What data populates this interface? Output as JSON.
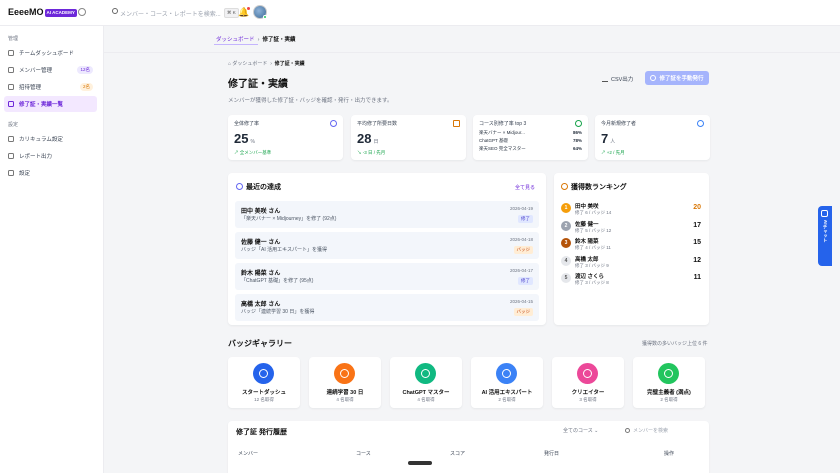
{
  "app": {
    "logo": "EeeeMO",
    "logo_badge": "AI ACADEMY"
  },
  "search": {
    "placeholder": "メンバー・コース・レポートを検索...",
    "shortcut": "⌘ K"
  },
  "sidebar": {
    "section_admin": "管理",
    "items": [
      {
        "label": "チームダッシュボード"
      },
      {
        "label": "メンバー管理",
        "count": "12名"
      },
      {
        "label": "招待管理",
        "count": "2名"
      },
      {
        "label": "修了証・実績一覧"
      }
    ],
    "section_settings": "設定",
    "settings_items": [
      {
        "label": "カリキュラム設定"
      },
      {
        "label": "レポート出力"
      },
      {
        "label": "設定"
      }
    ]
  },
  "breadcrumb_top": {
    "home": "ダッシュボード",
    "current": "修了証・実績"
  },
  "breadcrumb": {
    "home": "ダッシュボード",
    "current": "修了証・実績"
  },
  "page": {
    "title": "修了証・実績",
    "description": "メンバーが獲得した修了証・バッジを確認・発行・出力できます。",
    "csv_label": "CSV出力",
    "issue_label": "修了証を手動発行"
  },
  "stats": [
    {
      "label": "全体修了率",
      "value": "25",
      "unit": "%",
      "delta": "全メンバー基準"
    },
    {
      "label": "平均修了所要日数",
      "value": "28",
      "unit": "日",
      "delta": "-3 日 / 先月"
    },
    {
      "label": "コース別修了率 top 3",
      "rows": [
        {
          "name": "楽天バナー × Midjour...",
          "value": "86%"
        },
        {
          "name": "ChatGPT 基礎",
          "value": "78%"
        },
        {
          "name": "楽天SEO 完全マスター",
          "value": "64%"
        }
      ]
    },
    {
      "label": "今月新規修了者",
      "value": "7",
      "unit": "人",
      "delta": "+2 / 先月"
    }
  ],
  "recent": {
    "title": "最近の達成",
    "see_all": "全て見る",
    "items": [
      {
        "name": "田中 美咲 さん",
        "desc": "「楽天バナー × Midjourney」を修了 (92点)",
        "date": "2026-04-19",
        "tag": "修了"
      },
      {
        "name": "佐藤 健一 さん",
        "desc": "バッジ「AI 活用エキスパート」を獲得",
        "date": "2026-04-18",
        "tag": "バッジ"
      },
      {
        "name": "鈴木 陽菜 さん",
        "desc": "「ChatGPT 基礎」を修了 (95点)",
        "date": "2026-04-17",
        "tag": "修了"
      },
      {
        "name": "高橋 太郎 さん",
        "desc": "バッジ「連続学習 30 日」を獲得",
        "date": "2026-04-15",
        "tag": "バッジ"
      }
    ]
  },
  "ranking": {
    "title": "獲得数ランキング",
    "items": [
      {
        "rank": "1",
        "name": "田中 美咲",
        "sub": "修了 6 / バッジ 14",
        "score": "20",
        "color": "#f59e0b"
      },
      {
        "rank": "2",
        "name": "佐藤 健一",
        "sub": "修了 5 / バッジ 12",
        "score": "17",
        "color": "#9ca3af"
      },
      {
        "rank": "3",
        "name": "鈴木 陽菜",
        "sub": "修了 4 / バッジ 11",
        "score": "15",
        "color": "#b45309"
      },
      {
        "rank": "4",
        "name": "高橋 太郎",
        "sub": "修了 3 / バッジ 9",
        "score": "12",
        "color": "#e5e7eb"
      },
      {
        "rank": "5",
        "name": "渡辺 さくら",
        "sub": "修了 3 / バッジ 8",
        "score": "11",
        "color": "#e5e7eb"
      }
    ]
  },
  "gallery": {
    "title": "バッジギャラリー",
    "note": "獲得数の多いバッジ上位 6 件",
    "items": [
      {
        "name": "スタートダッシュ",
        "holders": "12 名取得",
        "color": "#2563eb"
      },
      {
        "name": "連続学習 30 日",
        "holders": "4 名取得",
        "color": "#f97316"
      },
      {
        "name": "ChatGPT マスター",
        "holders": "4 名取得",
        "color": "#10b981"
      },
      {
        "name": "AI 活用エキスパート",
        "holders": "2 名取得",
        "color": "#3b82f6"
      },
      {
        "name": "クリエイター",
        "holders": "3 名取得",
        "color": "#ec4899"
      },
      {
        "name": "完璧主義者 (満点)",
        "holders": "2 名取得",
        "color": "#22c55e"
      }
    ]
  },
  "history": {
    "title": "修了証 発行履歴",
    "filter": "全てのコース",
    "search_placeholder": "メンバーを検索",
    "columns": [
      "メンバー",
      "コース",
      "スコア",
      "発行日",
      "操作"
    ]
  },
  "chat": {
    "label": "AIチャット"
  }
}
